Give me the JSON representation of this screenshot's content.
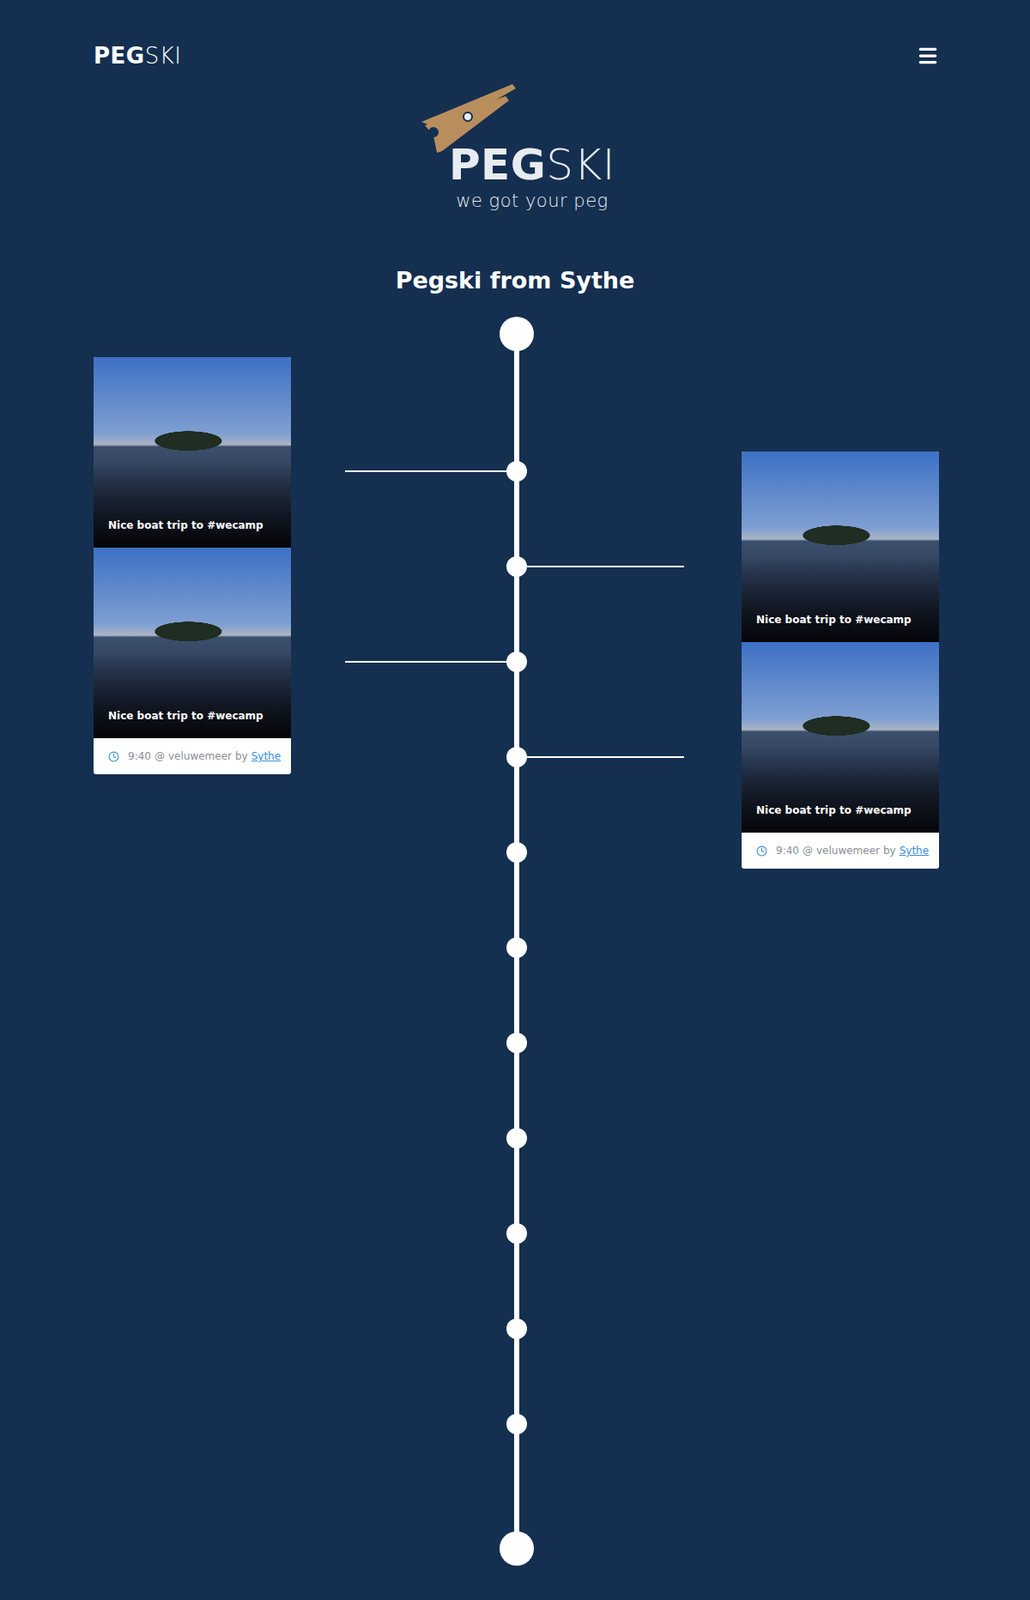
{
  "header": {
    "brand_bold": "PEG",
    "brand_light": "SKI"
  },
  "hero": {
    "brand_bold": "PEG",
    "brand_light": "SKI",
    "tagline": "we got your peg"
  },
  "title": "Pegski from Sythe",
  "timeline": {
    "markers": [
      {
        "connector": "left"
      },
      {
        "connector": "right"
      },
      {
        "connector": "left"
      },
      {
        "connector": "right"
      },
      {
        "connector": "none"
      },
      {
        "connector": "none"
      },
      {
        "connector": "none"
      },
      {
        "connector": "none"
      },
      {
        "connector": "none"
      },
      {
        "connector": "none"
      },
      {
        "connector": "none"
      }
    ]
  },
  "posts": [
    {
      "side": "left",
      "photos": [
        {
          "caption": "Nice boat trip to #wecamp"
        },
        {
          "caption": "Nice boat trip to #wecamp"
        }
      ],
      "meta": {
        "time": "9:40",
        "at": "@",
        "place": "veluwemeer",
        "by": "by",
        "author": "Sythe"
      }
    },
    {
      "side": "right",
      "photos": [
        {
          "caption": "Nice boat trip to #wecamp"
        },
        {
          "caption": "Nice boat trip to #wecamp"
        }
      ],
      "meta": {
        "time": "9:40",
        "at": "@",
        "place": "veluwemeer",
        "by": "by",
        "author": "Sythe"
      }
    }
  ]
}
